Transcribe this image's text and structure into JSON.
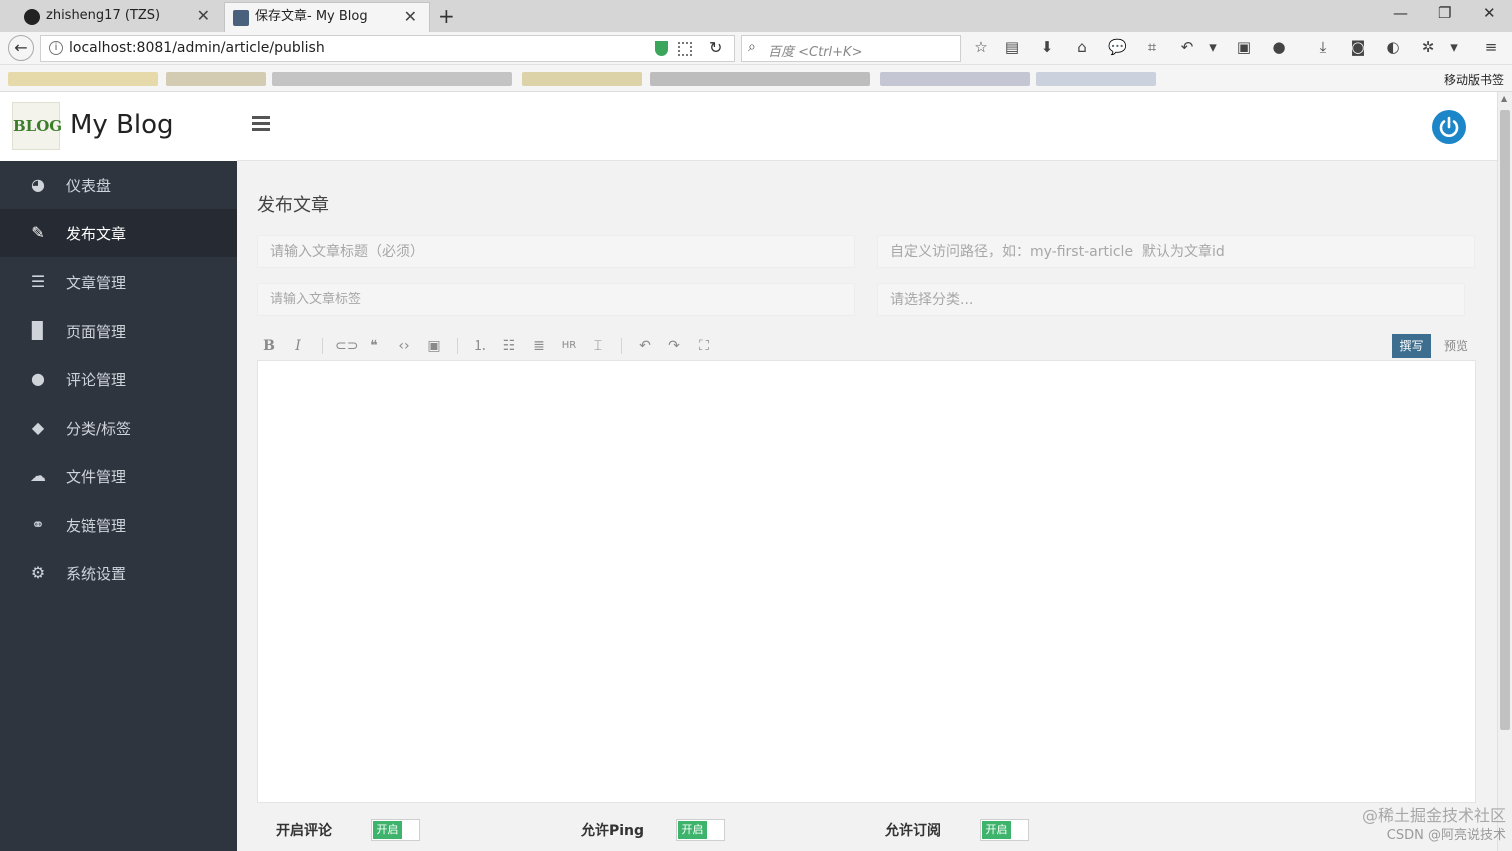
{
  "browser": {
    "tabs": [
      {
        "title": "zhisheng17 (TZS)"
      },
      {
        "title": "保存文章- My Blog"
      }
    ],
    "new_tab_symbol": "+",
    "window_controls": [
      "—",
      "❐",
      "✕"
    ],
    "url": "localhost:8081/admin/article/publish",
    "search_placeholder": "百度 <Ctrl+K>",
    "mobile_bookmarks_label": "移动版书签"
  },
  "app": {
    "logo_text": "BLOG",
    "title": "My Blog",
    "accent_color": "#1c86c8"
  },
  "sidebar": {
    "items": [
      {
        "label": "仪表盘",
        "icon": "dashboard-icon"
      },
      {
        "label": "发布文章",
        "icon": "edit-icon",
        "active": true
      },
      {
        "label": "文章管理",
        "icon": "list-icon"
      },
      {
        "label": "页面管理",
        "icon": "file-icon"
      },
      {
        "label": "评论管理",
        "icon": "comments-icon"
      },
      {
        "label": "分类/标签",
        "icon": "tags-icon"
      },
      {
        "label": "文件管理",
        "icon": "cloud-upload-icon"
      },
      {
        "label": "友链管理",
        "icon": "link-icon"
      },
      {
        "label": "系统设置",
        "icon": "gear-icon"
      }
    ]
  },
  "form": {
    "page_title": "发布文章",
    "title_placeholder": "请输入文章标题（必须）",
    "slug_placeholder": "自定义访问路径，如：my-first-article  默认为文章id",
    "tags_placeholder": "请输入文章标签",
    "category_placeholder": "请选择分类...",
    "write_label": "撰写",
    "preview_label": "预览",
    "options": [
      {
        "label": "开启评论",
        "state": "开启"
      },
      {
        "label": "允许Ping",
        "state": "开启"
      },
      {
        "label": "允许订阅",
        "state": "开启"
      }
    ]
  },
  "watermark": {
    "line1": "@稀土掘金技术社区",
    "line2": "CSDN @阿亮说技术"
  }
}
